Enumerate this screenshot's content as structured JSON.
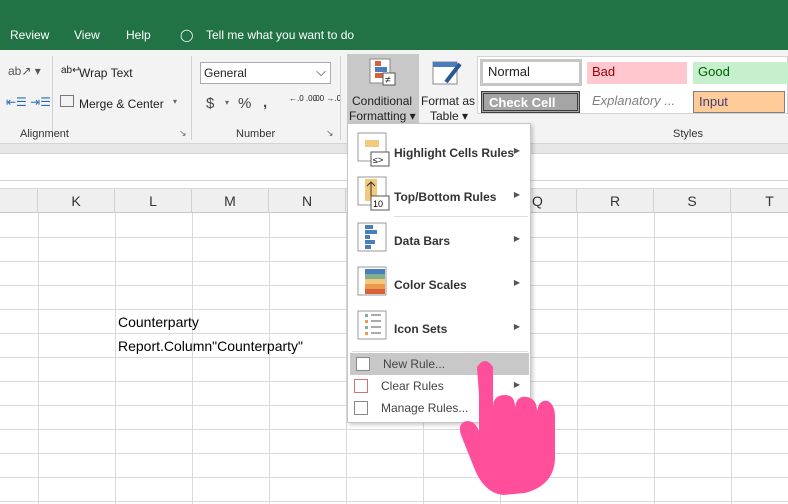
{
  "tabs": [
    "Review",
    "View",
    "Help"
  ],
  "tell_me": "Tell me what you want to do",
  "ribbon": {
    "alignment": {
      "wrap_text": "Wrap Text",
      "merge_center": "Merge & Center",
      "group": "Alignment"
    },
    "number": {
      "format": "General",
      "currency": "$",
      "percent": "%",
      "comma": ",",
      "inc_dec": "←.0 .00",
      "dec_dec": ".00 →.0",
      "group": "Number"
    },
    "conditional_formatting": [
      "Conditional",
      "Formatting ▾"
    ],
    "format_as_table": [
      "Format as",
      "Table ▾"
    ],
    "styles": {
      "normal": "Normal",
      "bad": "Bad",
      "good": "Good",
      "check_cell": "Check Cell",
      "explanatory": "Explanatory ...",
      "input": "Input",
      "group": "Styles"
    }
  },
  "columns": [
    "K",
    "L",
    "M",
    "N",
    "Q",
    "R",
    "S",
    "T"
  ],
  "cells": {
    "l14": "Counterparty",
    "l15": "Report.Column\"Counterparty\""
  },
  "menu": {
    "items": [
      {
        "label": "Highlight Cells Rules"
      },
      {
        "label": "Top/Bottom Rules"
      },
      {
        "label": "Data Bars"
      },
      {
        "label": "Color Scales"
      },
      {
        "label": "Icon Sets"
      }
    ],
    "small": [
      {
        "label": "New Rule..."
      },
      {
        "label": "Clear Rules"
      },
      {
        "label": "Manage Rules..."
      }
    ],
    "icon_text": {
      "highlight": "≤>",
      "top": "10"
    }
  },
  "colors": {
    "brand": "#217346",
    "cursor": "#ff4f9a",
    "hover": "#c8c8c8"
  }
}
